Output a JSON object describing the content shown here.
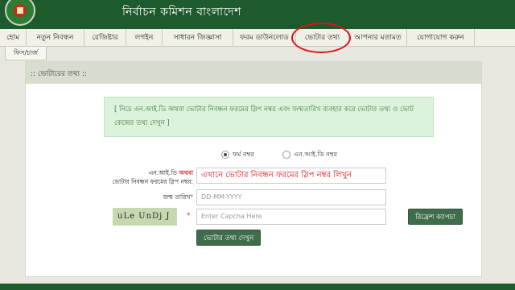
{
  "header": {
    "title": "নির্বাচন কমিশন বাংলাদেশ"
  },
  "nav": {
    "items": [
      "হোম",
      "নতুন নিবন্ধন",
      "রেজিষ্টার",
      "লগইন",
      "সাধারন জিজ্ঞাসা",
      "ফরম ডাউনলোড",
      "ভোটার তথ্য",
      "আপনার মতামত",
      "যোগাযোগ করুন"
    ],
    "fees_tab": "ফিস/চার্জ"
  },
  "panel": {
    "heading": ":: ভোটারের তথ্য ::",
    "info": "[ নিচে এন.আই.ডি অথবা ভোটার নিবন্ধন ফরমের স্লিপ নম্বর এবং জন্মতারিখ ব্যবহার করে ভোটার তথ্য ও ভোট কেন্দ্রের তথ্য দেখুন ]"
  },
  "form": {
    "radio_form_no": "ফর্ম নম্বর",
    "radio_nid_no": "এন.আই.ডি নম্বর",
    "slip_label_part1": "এন.আই.ডি",
    "slip_label_or": "অথবা",
    "slip_label_part2": "ভোটার নিবন্ধন ফরমের স্লিপ নম্বর",
    "slip_value": "এখানে ভোটার নিবন্ধন ফরমের স্লিপ নম্বর লিখুন",
    "dob_label": "জন্ম তারিখ",
    "dob_placeholder": "DD-MM-YYYY",
    "captcha_text": "uLe UnDj J",
    "captcha_placeholder": "Enter Capcha Here",
    "refresh_button": "রিফ্রেশ ক্যাপচা",
    "submit_button": "ভোটার তথ্য দেখুন",
    "required_mark": "*",
    "colon": ":"
  }
}
